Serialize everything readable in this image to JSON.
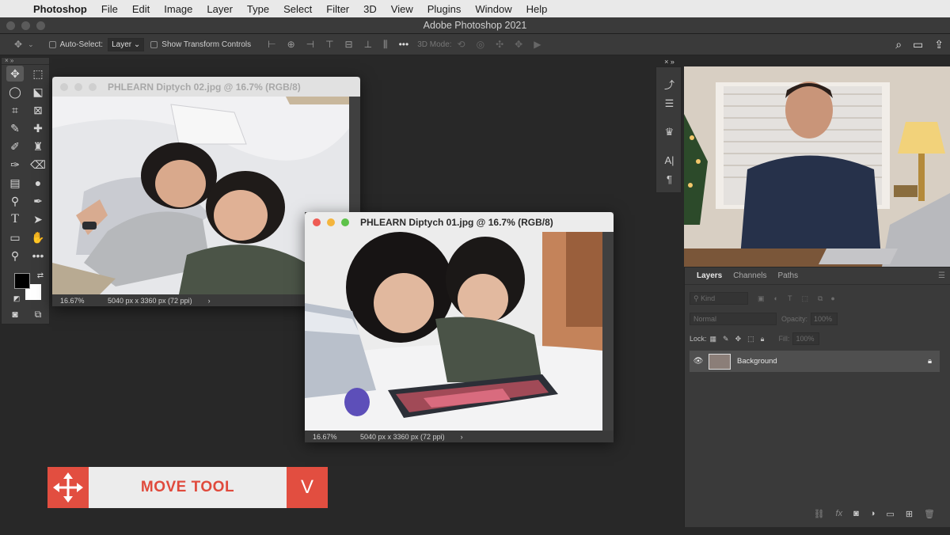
{
  "menubar": {
    "apple_icon": "apple-logo-icon",
    "app_name": "Photoshop",
    "items": [
      "File",
      "Edit",
      "Image",
      "Layer",
      "Type",
      "Select",
      "Filter",
      "3D",
      "View",
      "Plugins",
      "Window",
      "Help"
    ]
  },
  "window": {
    "title": "Adobe Photoshop 2021"
  },
  "options": {
    "auto_select_label": "Auto-Select:",
    "auto_select_value": "Layer",
    "transform_label": "Show Transform Controls",
    "mode_label": "3D Mode:"
  },
  "doc2": {
    "title": "PHLEARN Diptych 02.jpg @ 16.7% (RGB/8)",
    "zoom": "16.67%",
    "info": "5040 px x 3360 px (72 ppi)",
    "arrow": "›"
  },
  "doc1": {
    "title": "PHLEARN Diptych 01.jpg @ 16.7% (RGB/8)",
    "zoom": "16.67%",
    "info": "5040 px x 3360 px (72 ppi)",
    "arrow": "›"
  },
  "layers_panel": {
    "tabs": [
      "Layers",
      "Channels",
      "Paths"
    ],
    "kind_placeholder": "Kind",
    "blend_mode": "Normal",
    "opacity_label": "Opacity:",
    "opacity_value": "100%",
    "lock_label": "Lock:",
    "fill_label": "Fill:",
    "fill_value": "100%",
    "layer_name": "Background"
  },
  "banner": {
    "label": "MOVE TOOL",
    "shortcut": "V"
  },
  "colors": {
    "accent": "#e24e40",
    "foreground": "#000000",
    "background": "#ffffff"
  }
}
